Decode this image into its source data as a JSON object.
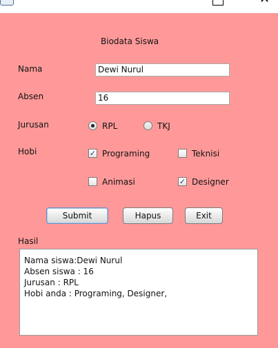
{
  "window": {
    "title": ""
  },
  "form": {
    "heading": "Biodata Siswa",
    "nama": {
      "label": "Nama",
      "value": "Dewi Nurul"
    },
    "absen": {
      "label": "Absen",
      "value": "16"
    },
    "jurusan": {
      "label": "Jurusan",
      "options": [
        {
          "label": "RPL",
          "selected": true
        },
        {
          "label": "TKJ",
          "selected": false
        }
      ]
    },
    "hobi": {
      "label": "Hobi",
      "options": [
        {
          "label": "Programing",
          "checked": true
        },
        {
          "label": "Teknisi",
          "checked": false
        },
        {
          "label": "Animasi",
          "checked": false
        },
        {
          "label": "Designer",
          "checked": true
        }
      ]
    },
    "buttons": {
      "submit": "Submit",
      "hapus": "Hapus",
      "exit": "Exit"
    },
    "hasil": {
      "label": "Hasil",
      "lines": [
        "Nama siswa:Dewi Nurul",
        "Absen siswa : 16",
        "Jurusan : RPL",
        "Hobi anda : Programing, Designer,"
      ]
    }
  },
  "colors": {
    "background": "#ff9999"
  }
}
